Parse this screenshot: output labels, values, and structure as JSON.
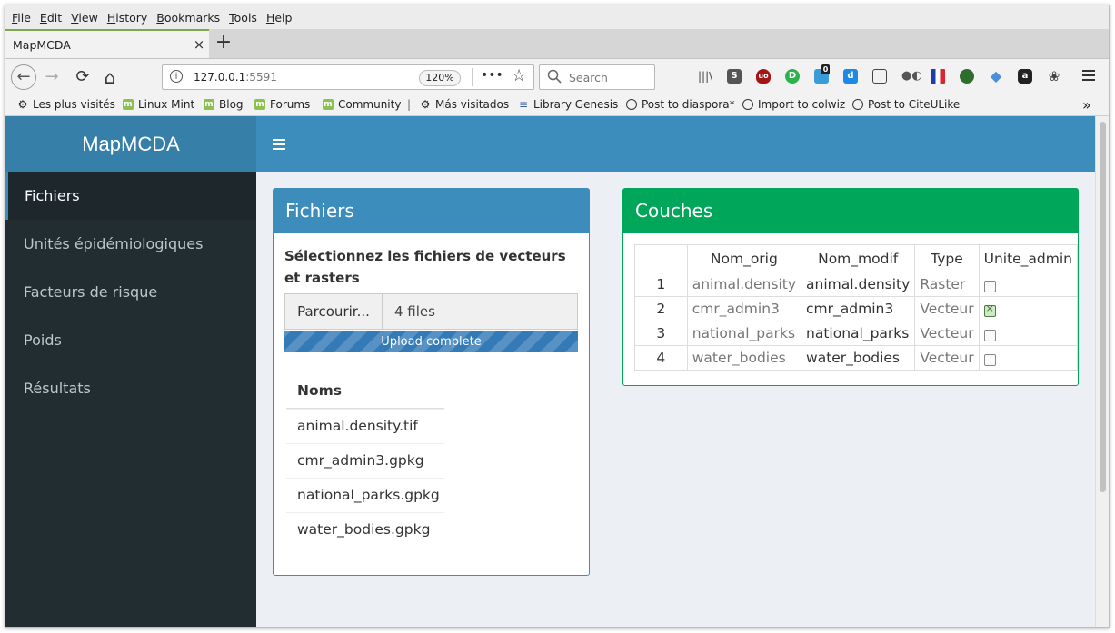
{
  "menubar": [
    "File",
    "Edit",
    "View",
    "History",
    "Bookmarks",
    "Tools",
    "Help"
  ],
  "tab": {
    "title": "MapMCDA",
    "close": "×",
    "new": "+"
  },
  "nav": {
    "back": "←",
    "forward": "→",
    "reload": "⟳",
    "home": "⌂",
    "info": "i",
    "url_host": "127.0.0.1",
    "url_port": ":5591",
    "zoom": "120%",
    "more": "•••",
    "star": "☆",
    "search_placeholder": "Search"
  },
  "extensions": [
    {
      "name": "library-icon",
      "color": "#555",
      "glyph": "|||\\"
    },
    {
      "name": "s-extension-icon",
      "color": "#555",
      "glyph": "S"
    },
    {
      "name": "ublock-icon",
      "color": "#a31515",
      "glyph": "u"
    },
    {
      "name": "green-d-icon",
      "color": "#2bb24c",
      "glyph": "D"
    },
    {
      "name": "notification-badge-icon",
      "color": "#3a9bd9",
      "glyph": "0"
    },
    {
      "name": "d-extension-icon",
      "color": "#1e88e5",
      "glyph": "d"
    },
    {
      "name": "reader-icon",
      "color": "#555",
      "glyph": "▤"
    },
    {
      "name": "masks-icon",
      "color": "#666",
      "glyph": "●"
    },
    {
      "name": "french-flag-icon",
      "color": "#fff",
      "glyph": ""
    },
    {
      "name": "turtle-icon",
      "color": "#2f6d2f",
      "glyph": "●"
    },
    {
      "name": "diamond-icon",
      "color": "#4a90d9",
      "glyph": "◆"
    },
    {
      "name": "lock-icon",
      "color": "#222",
      "glyph": "a"
    },
    {
      "name": "gear-extension-icon",
      "color": "#444",
      "glyph": "❀"
    }
  ],
  "bookmarks": [
    "Les plus visités",
    "Linux Mint",
    "Blog",
    "Forums",
    "Community",
    "|",
    "Más visitados",
    "Library Genesis",
    "Post to diaspora*",
    "Import to colwiz",
    "Post to CiteULike"
  ],
  "bookmarks_overflow": "»",
  "app": {
    "title": "MapMCDA"
  },
  "sidebar": [
    {
      "label": "Fichiers",
      "active": true
    },
    {
      "label": "Unités épidémiologiques",
      "active": false
    },
    {
      "label": "Facteurs de risque",
      "active": false
    },
    {
      "label": "Poids",
      "active": false
    },
    {
      "label": "Résultats",
      "active": false
    }
  ],
  "files_box": {
    "title": "Fichiers",
    "select_label": "Sélectionnez les fichiers de vecteurs et rasters",
    "browse": "Parcourir...",
    "count": "4 files",
    "progress": "Upload complete",
    "progress_percent": 100,
    "list_header": "Noms",
    "files": [
      "animal.density.tif",
      "cmr_admin3.gpkg",
      "national_parks.gpkg",
      "water_bodies.gpkg"
    ]
  },
  "couches_box": {
    "title": "Couches",
    "columns": [
      "",
      "Nom_orig",
      "Nom_modif",
      "Type",
      "Unite_admin"
    ],
    "rows": [
      {
        "n": "1",
        "orig": "animal.density",
        "modif": "animal.density",
        "type": "Raster",
        "admin": false
      },
      {
        "n": "2",
        "orig": "cmr_admin3",
        "modif": "cmr_admin3",
        "type": "Vecteur",
        "admin": true
      },
      {
        "n": "3",
        "orig": "national_parks",
        "modif": "national_parks",
        "type": "Vecteur",
        "admin": false
      },
      {
        "n": "4",
        "orig": "water_bodies",
        "modif": "water_bodies",
        "type": "Vecteur",
        "admin": false
      }
    ]
  }
}
